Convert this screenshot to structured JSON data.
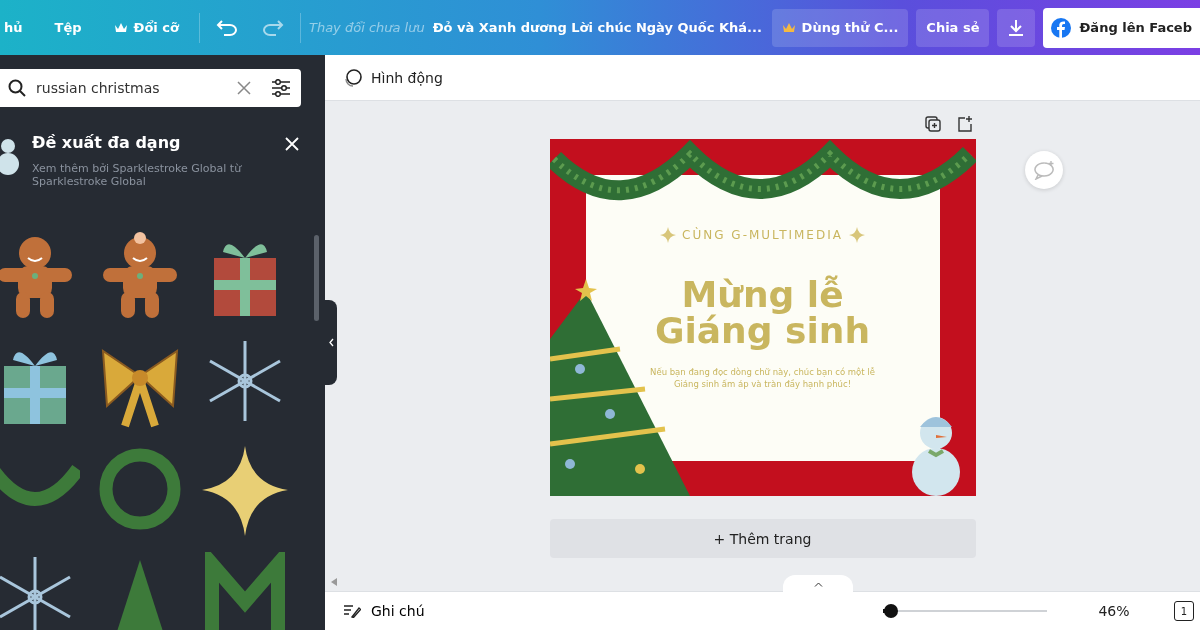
{
  "topbar": {
    "menu": [
      "hủ",
      "Tệp"
    ],
    "resize": "Đổi cỡ",
    "save_status": "Thay đổi chưa lưu",
    "doc_title": "Đỏ và Xanh dương Lời chúc Ngày Quốc Khá...",
    "trial": "Dùng thử C...",
    "share": "Chia sẻ",
    "publish": "Đăng lên Faceb"
  },
  "sidebar": {
    "search": {
      "value": "russian christmas"
    },
    "section_title": "Đề xuất đa dạng",
    "section_subtitle": "Xem thêm bởi Sparklestroke Global từ Sparklestroke Global",
    "stickers": [
      {
        "kind": "gingerbread"
      },
      {
        "kind": "gingerbread-girl"
      },
      {
        "kind": "gift-red"
      },
      {
        "kind": "gift-green"
      },
      {
        "kind": "bow"
      },
      {
        "kind": "snowflake"
      },
      {
        "kind": "garland"
      },
      {
        "kind": "wreath"
      },
      {
        "kind": "star"
      },
      {
        "kind": "snowflake"
      },
      {
        "kind": "tree"
      },
      {
        "kind": "garland-m"
      }
    ]
  },
  "toolbar": {
    "animate": "Hình động"
  },
  "design": {
    "tagline": "CÙNG G-MULTIMEDIA",
    "title_lines": [
      "Mừng lễ",
      "Giáng sinh"
    ],
    "message": "Nếu bạn đang đọc dòng chữ này, chúc bạn có một lễ Giáng sinh ấm áp và tràn đầy hạnh phúc!"
  },
  "add_page": "+ Thêm trang",
  "status_bar": {
    "notes": "Ghi chú",
    "zoom": {
      "level": 0.05
    },
    "zoom_reading": "46%",
    "page_count": "1"
  }
}
